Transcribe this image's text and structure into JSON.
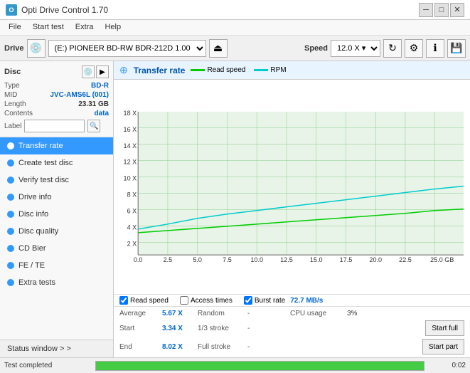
{
  "app": {
    "title": "Opti Drive Control 1.70",
    "icon": "O"
  },
  "titlebar": {
    "minimize": "─",
    "maximize": "□",
    "close": "✕"
  },
  "menubar": {
    "items": [
      "File",
      "Start test",
      "Extra",
      "Help"
    ]
  },
  "toolbar": {
    "drive_label": "Drive",
    "drive_value": "(E:) PIONEER BD-RW  BDR-212D 1.00",
    "speed_label": "Speed",
    "speed_value": "12.0 X ▾"
  },
  "disc": {
    "section_label": "Disc",
    "type_label": "Type",
    "type_value": "BD-R",
    "mid_label": "MID",
    "mid_value": "JVC-AMS6L (001)",
    "length_label": "Length",
    "length_value": "23.31 GB",
    "contents_label": "Contents",
    "contents_value": "data",
    "label_label": "Label",
    "label_placeholder": ""
  },
  "nav": {
    "items": [
      {
        "id": "transfer-rate",
        "label": "Transfer rate",
        "active": true
      },
      {
        "id": "create-test-disc",
        "label": "Create test disc",
        "active": false
      },
      {
        "id": "verify-test-disc",
        "label": "Verify test disc",
        "active": false
      },
      {
        "id": "drive-info",
        "label": "Drive info",
        "active": false
      },
      {
        "id": "disc-info",
        "label": "Disc info",
        "active": false
      },
      {
        "id": "disc-quality",
        "label": "Disc quality",
        "active": false
      },
      {
        "id": "cd-bier",
        "label": "CD Bier",
        "active": false
      },
      {
        "id": "fe-te",
        "label": "FE / TE",
        "active": false
      },
      {
        "id": "extra-tests",
        "label": "Extra tests",
        "active": false
      }
    ],
    "status_window": "Status window > >"
  },
  "chart": {
    "title": "Transfer rate",
    "legend": {
      "read_speed_label": "Read speed",
      "read_speed_color": "#00cc00",
      "rpm_label": "RPM",
      "rpm_color": "#00cccc"
    },
    "y_axis": [
      "18 X",
      "16 X",
      "14 X",
      "12 X",
      "10 X",
      "8 X",
      "6 X",
      "4 X",
      "2 X"
    ],
    "x_axis": [
      "0.0",
      "2.5",
      "5.0",
      "7.5",
      "10.0",
      "12.5",
      "15.0",
      "17.5",
      "20.0",
      "22.5",
      "25.0 GB"
    ],
    "checkboxes": {
      "read_speed": {
        "label": "Read speed",
        "checked": true
      },
      "access_times": {
        "label": "Access times",
        "checked": false
      },
      "burst_rate": {
        "label": "Burst rate",
        "checked": true,
        "value": "72.7 MB/s"
      }
    }
  },
  "stats": {
    "average_label": "Average",
    "average_value": "5.67 X",
    "random_label": "Random",
    "random_value": "-",
    "cpu_label": "CPU usage",
    "cpu_value": "3%",
    "start_label": "Start",
    "start_value": "3.34 X",
    "stroke13_label": "1/3 stroke",
    "stroke13_value": "-",
    "start_full_label": "Start full",
    "end_label": "End",
    "end_value": "8.02 X",
    "full_stroke_label": "Full stroke",
    "full_stroke_value": "-",
    "start_part_label": "Start part"
  },
  "statusbar": {
    "text": "Test completed",
    "progress": 100,
    "time": "0:02"
  }
}
